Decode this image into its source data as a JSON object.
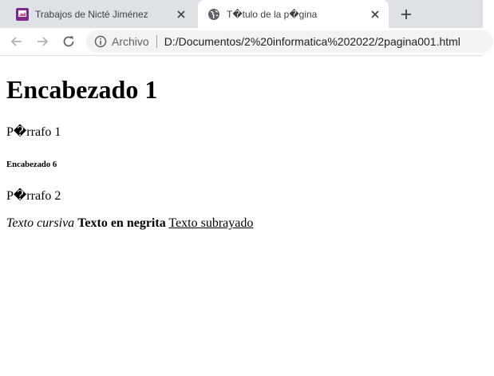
{
  "browser": {
    "tabs": [
      {
        "title": "Trabajos de Nicté Jiménez",
        "favicon": "purple-app-icon",
        "active": false
      },
      {
        "title": "T�tulo de la p�gina",
        "favicon": "globe-icon",
        "active": true
      }
    ],
    "new_tab_icon": "plus-icon",
    "address_bar": {
      "scheme_label": "Archivo",
      "url": "D:/Documentos/2%20informatica%202022/2pagina001.html"
    }
  },
  "page": {
    "h1": "Encabezado 1",
    "paragraph_1": "P�rrafo 1",
    "h6": "Encabezado 6",
    "paragraph_2": "P�rrafo 2",
    "italic_text": "Texto cursiva",
    "bold_text": "Texto en negrita",
    "underline_text": "Texto subrayado"
  },
  "colors": {
    "tabstrip": "#dee1e6",
    "omnibox": "#f1f3f4",
    "favicon_purple": "#7b2a8c"
  }
}
